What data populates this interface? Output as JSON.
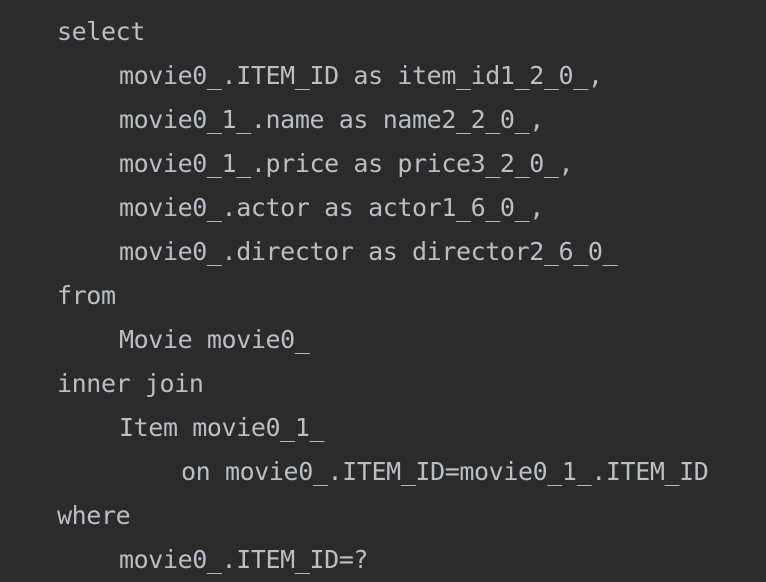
{
  "code": {
    "lines": [
      {
        "indent": 0,
        "text": "select"
      },
      {
        "indent": 1,
        "text": "movie0_.ITEM_ID as item_id1_2_0_,"
      },
      {
        "indent": 1,
        "text": "movie0_1_.name as name2_2_0_,"
      },
      {
        "indent": 1,
        "text": "movie0_1_.price as price3_2_0_,"
      },
      {
        "indent": 1,
        "text": "movie0_.actor as actor1_6_0_,"
      },
      {
        "indent": 1,
        "text": "movie0_.director as director2_6_0_"
      },
      {
        "indent": 0,
        "text": "from"
      },
      {
        "indent": 1,
        "text": "Movie movie0_"
      },
      {
        "indent": 0,
        "text": "inner join"
      },
      {
        "indent": 1,
        "text": "Item movie0_1_"
      },
      {
        "indent": 2,
        "text": "on movie0_.ITEM_ID=movie0_1_.ITEM_ID"
      },
      {
        "indent": 0,
        "text": "where"
      },
      {
        "indent": 1,
        "text": "movie0_.ITEM_ID=?"
      }
    ]
  },
  "colors": {
    "background": "#2b2b2b",
    "text": "#bcbec4"
  }
}
